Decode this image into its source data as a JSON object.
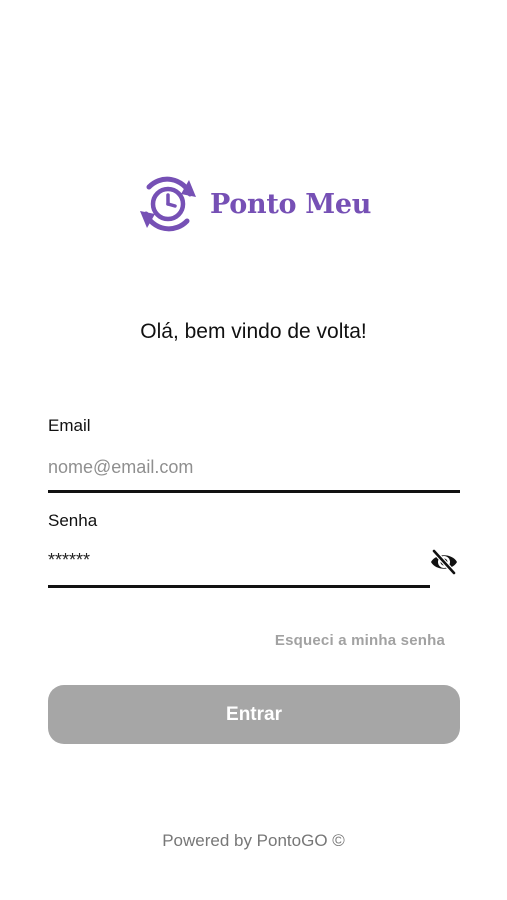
{
  "brand": {
    "name": "Ponto Meu",
    "color": "#7650b5",
    "icon": "clock-refresh-icon"
  },
  "greeting": "Olá, bem vindo de volta!",
  "email_field": {
    "label": "Email",
    "placeholder": "nome@email.com",
    "value": ""
  },
  "password_field": {
    "label": "Senha",
    "value": "******",
    "toggle_icon": "eye-off-icon"
  },
  "forgot_password": "Esqueci a minha senha",
  "login_button": {
    "label": "Entrar",
    "color": "#a6a6a6"
  },
  "footer": "Powered by PontoGO ©"
}
